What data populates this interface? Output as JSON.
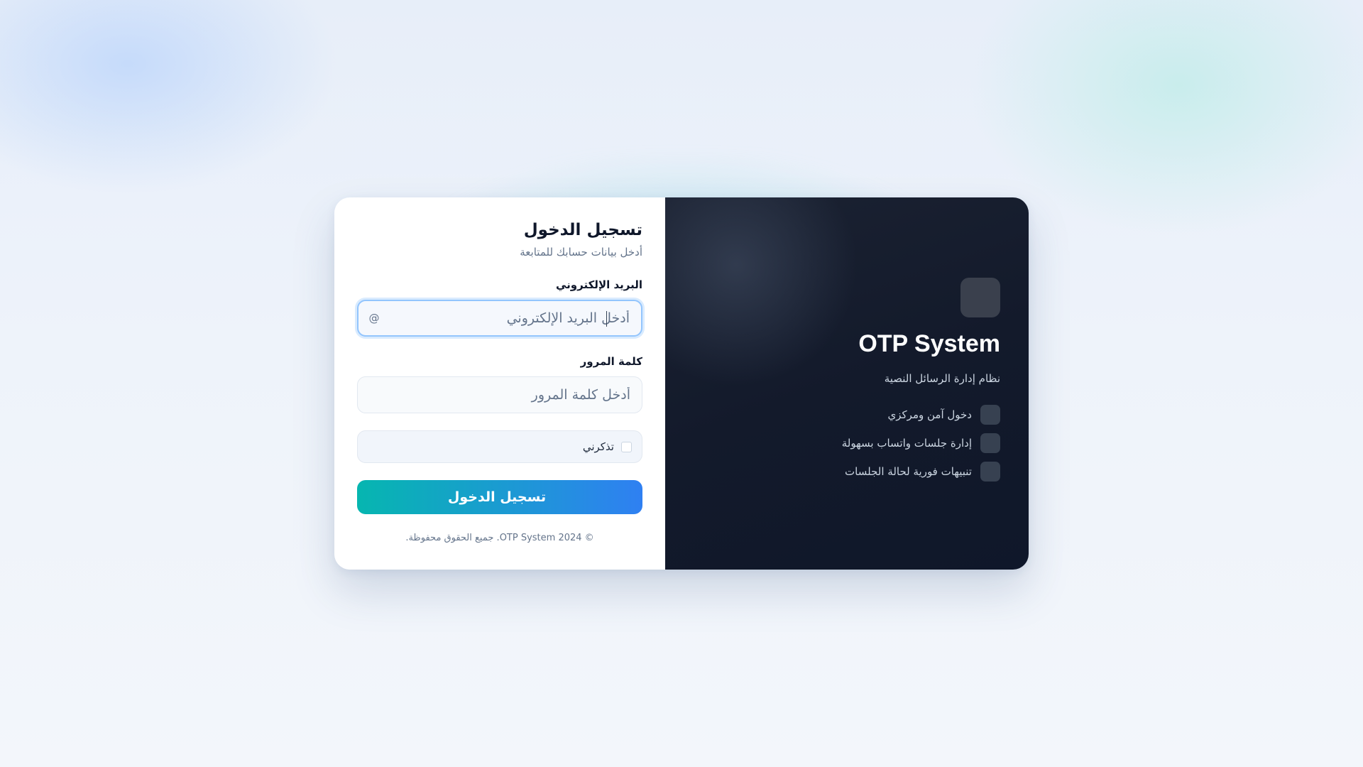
{
  "form": {
    "title": "تسجيل الدخول",
    "subtitle": "أدخل بيانات حسابك للمتابعة",
    "email": {
      "label": "البريد الإلكتروني",
      "placeholder": "أدخل البريد الإلكتروني",
      "value": "",
      "icon_char": "@",
      "icon": "at-sign-icon"
    },
    "password": {
      "label": "كلمة المرور",
      "placeholder": "أدخل كلمة المرور",
      "value": "",
      "icon_char": "",
      "icon": "lock-icon"
    },
    "remember_label": "تذكرني",
    "submit_label": "تسجيل الدخول",
    "submit_icon_char": "",
    "footer": "© 2024 OTP System. جميع الحقوق محفوظة."
  },
  "brand_panel": {
    "logo_char": "",
    "logo_icon": "shield-icon",
    "name": "OTP System",
    "tagline": "نظام إدارة الرسائل النصية",
    "features": [
      {
        "icon_char": "",
        "icon": "lock-icon",
        "text": "دخول آمن ومركزي"
      },
      {
        "icon_char": "",
        "icon": "whatsapp-icon",
        "text": "إدارة جلسات واتساب بسهولة"
      },
      {
        "icon_char": "",
        "icon": "bell-icon",
        "text": "تنبيهات فورية لحالة الجلسات"
      }
    ]
  },
  "colors": {
    "accent_start": "#2f80f2",
    "accent_end": "#06b6b0",
    "dark_panel": "#0f172a"
  }
}
